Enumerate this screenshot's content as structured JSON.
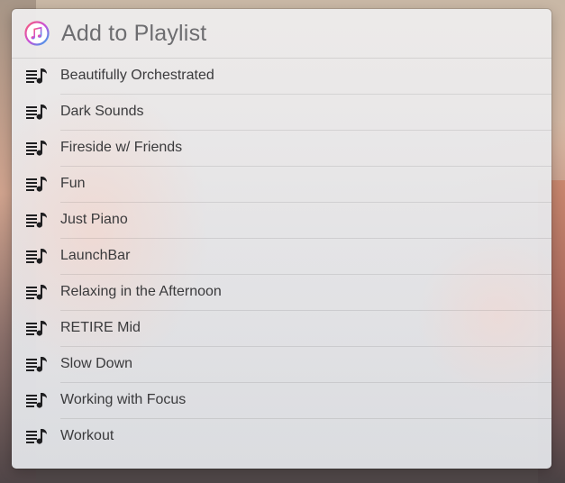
{
  "window": {
    "title": "Add to Playlist",
    "app_icon": "itunes-icon"
  },
  "playlists": {
    "item_icon": "playlist-icon",
    "items": [
      {
        "label": "Beautifully Orchestrated"
      },
      {
        "label": "Dark Sounds"
      },
      {
        "label": "Fireside w/ Friends"
      },
      {
        "label": "Fun"
      },
      {
        "label": "Just Piano"
      },
      {
        "label": "LaunchBar"
      },
      {
        "label": "Relaxing in the Afternoon"
      },
      {
        "label": "RETIRE Mid"
      },
      {
        "label": "Slow Down"
      },
      {
        "label": "Working with Focus"
      },
      {
        "label": "Workout"
      }
    ]
  },
  "colors": {
    "title_text": "#6d6d70",
    "item_text": "#3a3a3c",
    "itunes_pink": "#e8458f",
    "itunes_blue": "#2ea7ee"
  }
}
